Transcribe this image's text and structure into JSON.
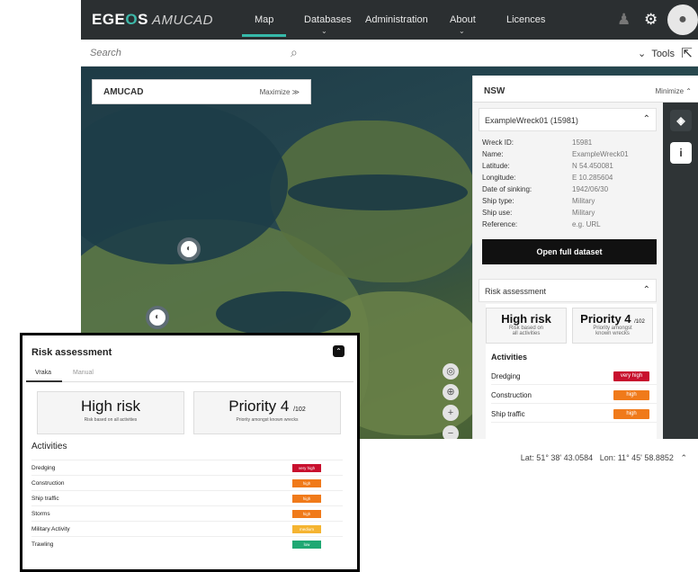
{
  "brand": {
    "name_part1": "EGE",
    "name_accent": "O",
    "name_part2": "S",
    "sub": "AMUCAD"
  },
  "nav": {
    "map": "Map",
    "databases": "Databases",
    "administration": "Administration",
    "about": "About",
    "licences": "Licences"
  },
  "search": {
    "placeholder": "Search"
  },
  "tools": {
    "label": "Tools"
  },
  "amucad_panel": {
    "title": "AMUCAD",
    "action": "Maximize"
  },
  "nsw_panel": {
    "title": "NSW",
    "action": "Minimize",
    "wreck_header": "ExampleWreck01 (15981)",
    "fields": [
      {
        "k": "Wreck ID:",
        "v": "15981"
      },
      {
        "k": "Name:",
        "v": "ExampleWreck01"
      },
      {
        "k": "Latitude:",
        "v": "N 54.450081"
      },
      {
        "k": "Longitude:",
        "v": "E 10.285604"
      },
      {
        "k": "Date of sinking:",
        "v": "1942/06/30"
      },
      {
        "k": "Ship type:",
        "v": "Military"
      },
      {
        "k": "Ship use:",
        "v": "Military"
      },
      {
        "k": "Reference:",
        "v": "e.g. URL"
      }
    ],
    "open_button": "Open full dataset",
    "risk_header": "Risk assessment",
    "risk_level": "High risk",
    "risk_sub1": "Risk based on",
    "risk_sub2": "all activities",
    "priority_label": "Priority 4",
    "priority_of": "/102",
    "priority_sub1": "Priority amongst",
    "priority_sub2": "known wrecks",
    "activities_title": "Activities",
    "activities": [
      {
        "name": "Dredging",
        "level": "very high",
        "color": "#c8102e"
      },
      {
        "name": "Construction",
        "level": "high",
        "color": "#f07a1a"
      },
      {
        "name": "Ship traffic",
        "level": "high",
        "color": "#f07a1a"
      }
    ]
  },
  "coords": {
    "lat": "Lat: 51° 38' 43.0584",
    "lon": "Lon: 11° 45' 58.8852"
  },
  "overlay": {
    "title": "Risk assessment",
    "tabs": [
      "Vraka",
      "Manual"
    ],
    "risk_level": "High risk",
    "risk_sub": "Risk based on all activities",
    "priority_label": "Priority 4",
    "priority_of": "/102",
    "priority_sub": "Priority amongst known wrecks",
    "activities_title": "Activities",
    "activities": [
      {
        "name": "Dredging",
        "level": "very high",
        "color": "#c8102e"
      },
      {
        "name": "Construction",
        "level": "high",
        "color": "#f07a1a"
      },
      {
        "name": "Ship traffic",
        "level": "high",
        "color": "#f07a1a"
      },
      {
        "name": "Storms",
        "level": "high",
        "color": "#f07a1a"
      },
      {
        "name": "Military Activity",
        "level": "medium",
        "color": "#f5b431"
      },
      {
        "name": "Trawling",
        "level": "low",
        "color": "#1fa873"
      }
    ]
  }
}
